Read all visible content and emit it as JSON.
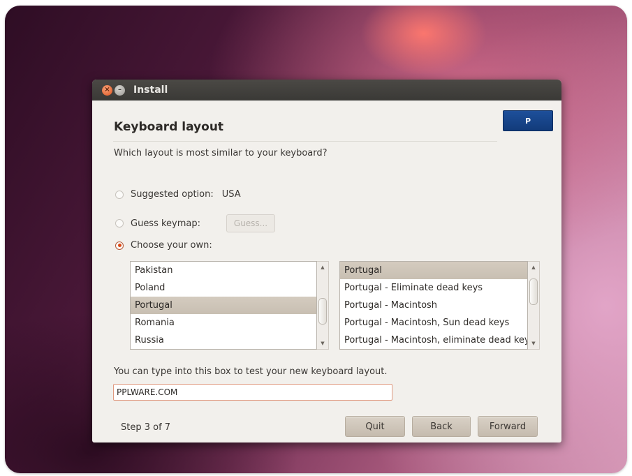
{
  "window": {
    "title": "Install"
  },
  "header": {
    "title": "Keyboard layout",
    "logo_text": "pplware"
  },
  "question": "Which layout is most similar to your keyboard?",
  "options": {
    "suggested": {
      "label": "Suggested option:",
      "value": "USA",
      "selected": false
    },
    "guess": {
      "label": "Guess keymap:",
      "button_label": "Guess...",
      "selected": false
    },
    "choose": {
      "label": "Choose your own:",
      "selected": true
    }
  },
  "country_list": {
    "items": [
      "Pakistan",
      "Poland",
      "Portugal",
      "Romania",
      "Russia"
    ],
    "selected": "Portugal"
  },
  "variant_list": {
    "items": [
      "Portugal",
      "Portugal - Eliminate dead keys",
      "Portugal - Macintosh",
      "Portugal - Macintosh, Sun dead keys",
      "Portugal - Macintosh, eliminate dead keys"
    ],
    "selected": "Portugal"
  },
  "test": {
    "label": "You can type into this box to test your new keyboard layout.",
    "value": "PPLWARE.COM"
  },
  "footer": {
    "step": "Step 3 of 7",
    "quit_label": "Quit",
    "back_label": "Back",
    "forward_label": "Forward"
  },
  "colors": {
    "accent": "#dd4814",
    "titlebar": "#3c3b37",
    "window_bg": "#f2f0ec"
  }
}
